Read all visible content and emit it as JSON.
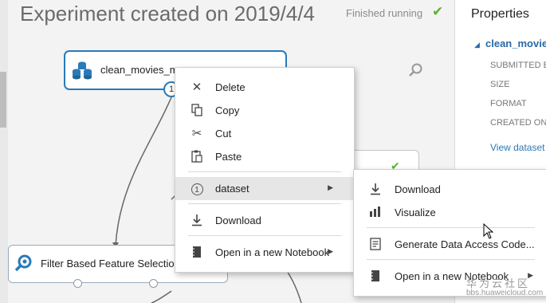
{
  "header": {
    "title": "Experiment created on 2019/4/4",
    "status_text": "Finished running",
    "status_check": "✔",
    "colors": {
      "status_ok": "#5bb12f",
      "accent": "#2a7ab8"
    }
  },
  "canvas": {
    "dataset_node": {
      "label": "clean_movies_m",
      "port_label": "1",
      "icon": "dataset-stack-icon"
    },
    "filter_node": {
      "label": "Filter Based Feature Selection",
      "icon": "feature-selection-icon"
    },
    "third_node_check": "✔"
  },
  "context_menu": {
    "items": [
      {
        "label": "Delete",
        "icon": "delete-x-icon"
      },
      {
        "label": "Copy",
        "icon": "copy-icon"
      },
      {
        "label": "Cut",
        "icon": "cut-scissors-icon"
      },
      {
        "label": "Paste",
        "icon": "paste-icon"
      },
      {
        "label": "dataset",
        "icon": "port-number-icon",
        "badge": "1"
      },
      {
        "label": "Download",
        "icon": "download-icon"
      },
      {
        "label": "Open in a new Notebook",
        "icon": "notebook-icon"
      }
    ]
  },
  "submenu": {
    "items": [
      {
        "label": "Download",
        "icon": "download-icon"
      },
      {
        "label": "Visualize",
        "icon": "visualize-bars-icon"
      },
      {
        "label": "Generate Data Access Code...",
        "icon": "code-doc-icon"
      },
      {
        "label": "Open in a new Notebook",
        "icon": "notebook-icon"
      }
    ]
  },
  "properties": {
    "title": "Properties",
    "node_name": "clean_movie",
    "fields": [
      "SUBMITTED B",
      "SIZE",
      "FORMAT",
      "CREATED ON"
    ],
    "link": "View dataset"
  },
  "watermark": {
    "line1": "华为云社区",
    "line2": "bbs.huaweicloud.com"
  }
}
